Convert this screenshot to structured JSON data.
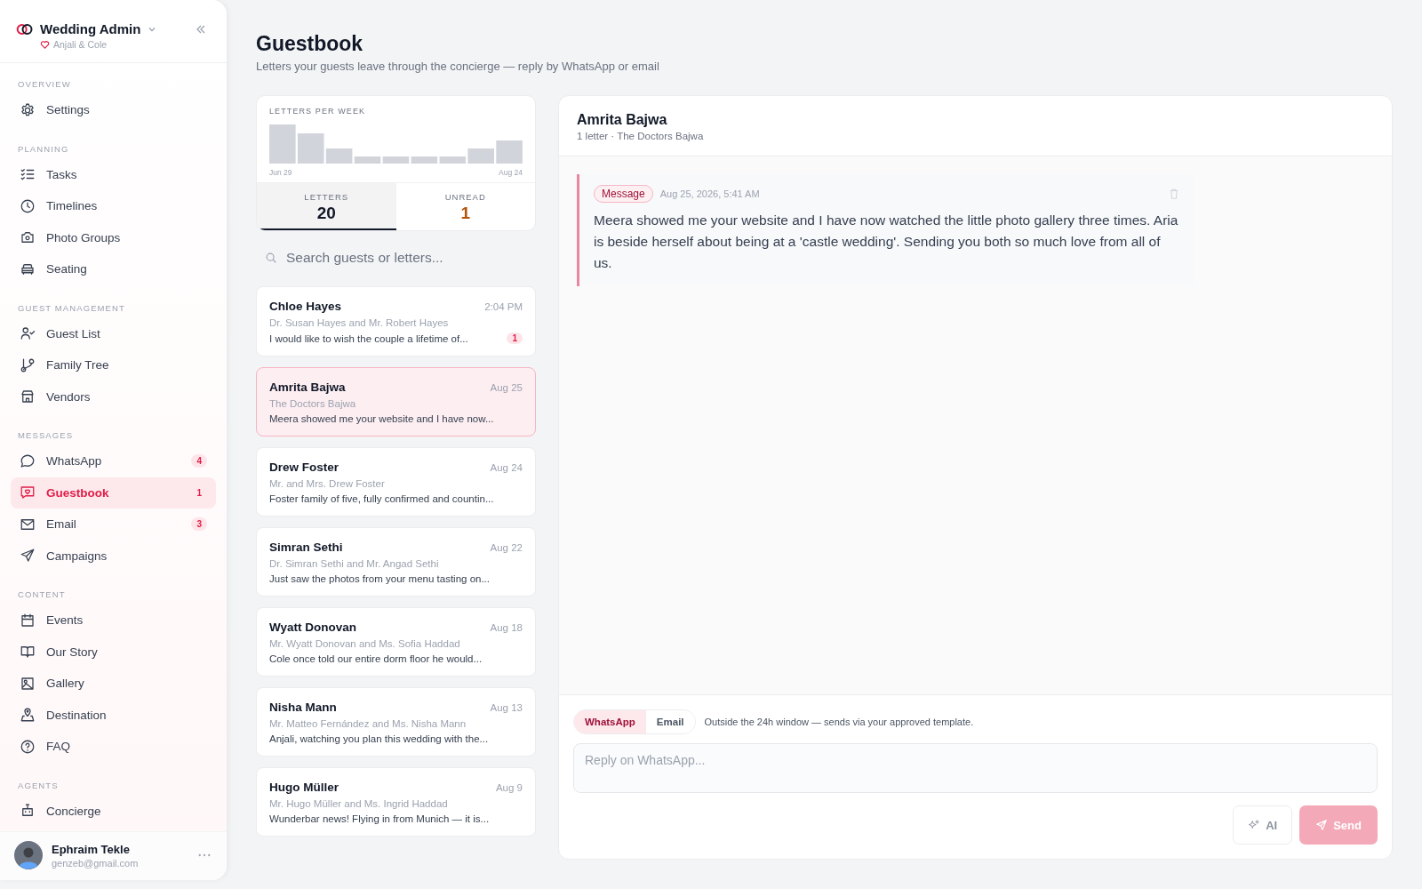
{
  "sidebar": {
    "brand": "Wedding Admin",
    "couple": "Anjali & Cole",
    "sections": [
      {
        "title": "OVERVIEW",
        "items": [
          {
            "label": "Settings",
            "selected": false
          }
        ]
      },
      {
        "title": "PLANNING",
        "items": [
          {
            "label": "Tasks",
            "selected": false
          },
          {
            "label": "Timelines",
            "selected": false
          },
          {
            "label": "Photo Groups",
            "selected": false
          },
          {
            "label": "Seating",
            "selected": false
          }
        ]
      },
      {
        "title": "GUEST MANAGEMENT",
        "items": [
          {
            "label": "Guest List",
            "selected": false
          },
          {
            "label": "Family Tree",
            "selected": false
          },
          {
            "label": "Vendors",
            "selected": false
          }
        ]
      },
      {
        "title": "MESSAGES",
        "items": [
          {
            "label": "WhatsApp",
            "selected": false,
            "badge": "4"
          },
          {
            "label": "Guestbook",
            "selected": true,
            "badge": "1"
          },
          {
            "label": "Email",
            "selected": false,
            "badge": "3"
          },
          {
            "label": "Campaigns",
            "selected": false
          }
        ]
      },
      {
        "title": "CONTENT",
        "items": [
          {
            "label": "Events",
            "selected": false
          },
          {
            "label": "Our Story",
            "selected": false
          },
          {
            "label": "Gallery",
            "selected": false
          },
          {
            "label": "Destination",
            "selected": false
          },
          {
            "label": "FAQ",
            "selected": false
          }
        ]
      },
      {
        "title": "AGENTS",
        "items": [
          {
            "label": "Concierge",
            "selected": false
          }
        ]
      }
    ],
    "user": {
      "name": "Ephraim Tekle",
      "email": "genzeb@gmail.com"
    }
  },
  "page": {
    "title": "Guestbook",
    "subtitle": "Letters your guests leave through the concierge — reply by WhatsApp or email"
  },
  "stats": {
    "chart_title": "LETTERS PER WEEK",
    "start_label": "Jun 29",
    "end_label": "Aug 24",
    "tabs": [
      {
        "label": "LETTERS",
        "value": "20",
        "selected": true,
        "kind": "total"
      },
      {
        "label": "UNREAD",
        "value": "1",
        "selected": false,
        "kind": "unread"
      }
    ]
  },
  "search": {
    "placeholder": "Search guests or letters..."
  },
  "letters": [
    {
      "name": "Chloe Hayes",
      "time": "2:04 PM",
      "household": "Dr. Susan Hayes and Mr. Robert Hayes",
      "preview": "I would like to wish the couple a lifetime of...",
      "unread": "1",
      "selected": false
    },
    {
      "name": "Amrita Bajwa",
      "time": "Aug 25",
      "household": "The Doctors Bajwa",
      "preview": "Meera showed me your website and I have now...",
      "selected": true
    },
    {
      "name": "Drew Foster",
      "time": "Aug 24",
      "household": "Mr. and Mrs. Drew Foster",
      "preview": "Foster family of five, fully confirmed and countin...",
      "selected": false
    },
    {
      "name": "Simran Sethi",
      "time": "Aug 22",
      "household": "Dr. Simran Sethi and Mr. Angad Sethi",
      "preview": "Just saw the photos from your menu tasting on...",
      "selected": false
    },
    {
      "name": "Wyatt Donovan",
      "time": "Aug 18",
      "household": "Mr. Wyatt Donovan and Ms. Sofia Haddad",
      "preview": "Cole once told our entire dorm floor he would...",
      "selected": false
    },
    {
      "name": "Nisha Mann",
      "time": "Aug 13",
      "household": "Mr. Matteo Fernández and Ms. Nisha Mann",
      "preview": "Anjali, watching you plan this wedding with the...",
      "selected": false
    },
    {
      "name": "Hugo Müller",
      "time": "Aug 9",
      "household": "Mr. Hugo Müller and Ms. Ingrid Haddad",
      "preview": "Wunderbar news! Flying in from Munich — it is...",
      "selected": false
    }
  ],
  "detail": {
    "name": "Amrita Bajwa",
    "meta": "1 letter · The Doctors Bajwa",
    "messages": [
      {
        "tag": "Message",
        "time": "Aug 25, 2026, 5:41 AM",
        "text": "Meera showed me your website and I have now watched the little photo gallery three times. Aria is beside herself about being at a 'castle wedding'. Sending you both so much love from all of us."
      }
    ],
    "composer": {
      "channels": [
        {
          "label": "WhatsApp",
          "selected": true
        },
        {
          "label": "Email",
          "selected": false
        }
      ],
      "note": "Outside the 24h window — sends via your approved template.",
      "placeholder": "Reply on WhatsApp...",
      "ai_button": {
        "label": "AI",
        "disabled": true
      },
      "send_button": {
        "label": "Send",
        "disabled": true
      }
    }
  }
}
